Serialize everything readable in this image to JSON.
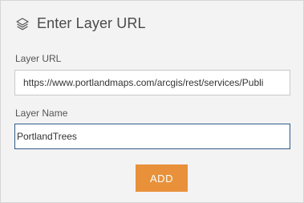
{
  "dialog": {
    "title": "Enter Layer URL",
    "title_icon": "layers-icon"
  },
  "layer_url": {
    "label": "Layer URL",
    "value": "https://www.portlandmaps.com/arcgis/rest/services/Publi"
  },
  "layer_name": {
    "label": "Layer Name",
    "value": "PortlandTrees"
  },
  "add_button": {
    "label": "ADD",
    "color": "#e8913a"
  }
}
